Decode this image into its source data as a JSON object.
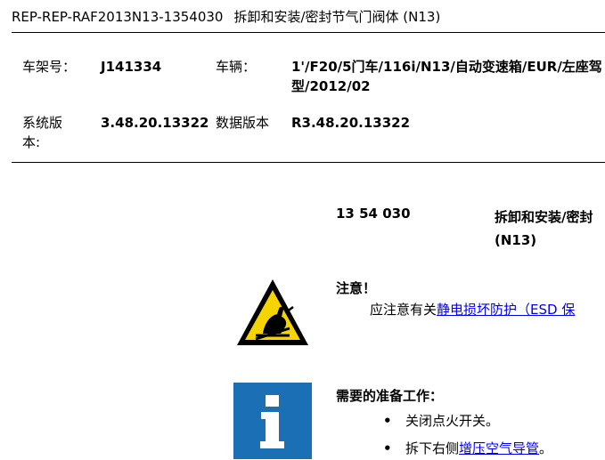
{
  "header": {
    "code": "REP-REP-RAF2013N13-1354030",
    "name": "拆卸和安装/密封节气门阀体 (N13)"
  },
  "info_table": {
    "vin_label": "车架号：",
    "vin_value": "J141334",
    "vehicle_label": "车辆：",
    "vehicle_value": "1'/F20/5门车/116i/N13/自动变速箱/EUR/左座驾型/2012/02",
    "system_version_label": "系统版本:",
    "system_version_value": "3.48.20.13322",
    "data_version_label": "数据版本",
    "data_version_value": "R3.48.20.13322"
  },
  "operation": {
    "number": "13 54 030",
    "name_line1": "拆卸和安装/密封",
    "name_line2": "(N13)"
  },
  "note": {
    "icon": "esd-warning-icon",
    "title": "注意！",
    "text_prefix": "应注意有关",
    "link_text": "静电损坏防护（ESD 保"
  },
  "preparation": {
    "icon": "info-icon",
    "title": "需要的准备工作：",
    "items": [
      {
        "text": "关闭点火开关。",
        "link": "",
        "suffix": ""
      },
      {
        "text": "拆下右侧",
        "link": "增压空气导管",
        "suffix": "。"
      }
    ]
  },
  "colors": {
    "link": "#0000ee",
    "warning_yellow": "#f5d400",
    "info_blue": "#1a6fb5"
  }
}
